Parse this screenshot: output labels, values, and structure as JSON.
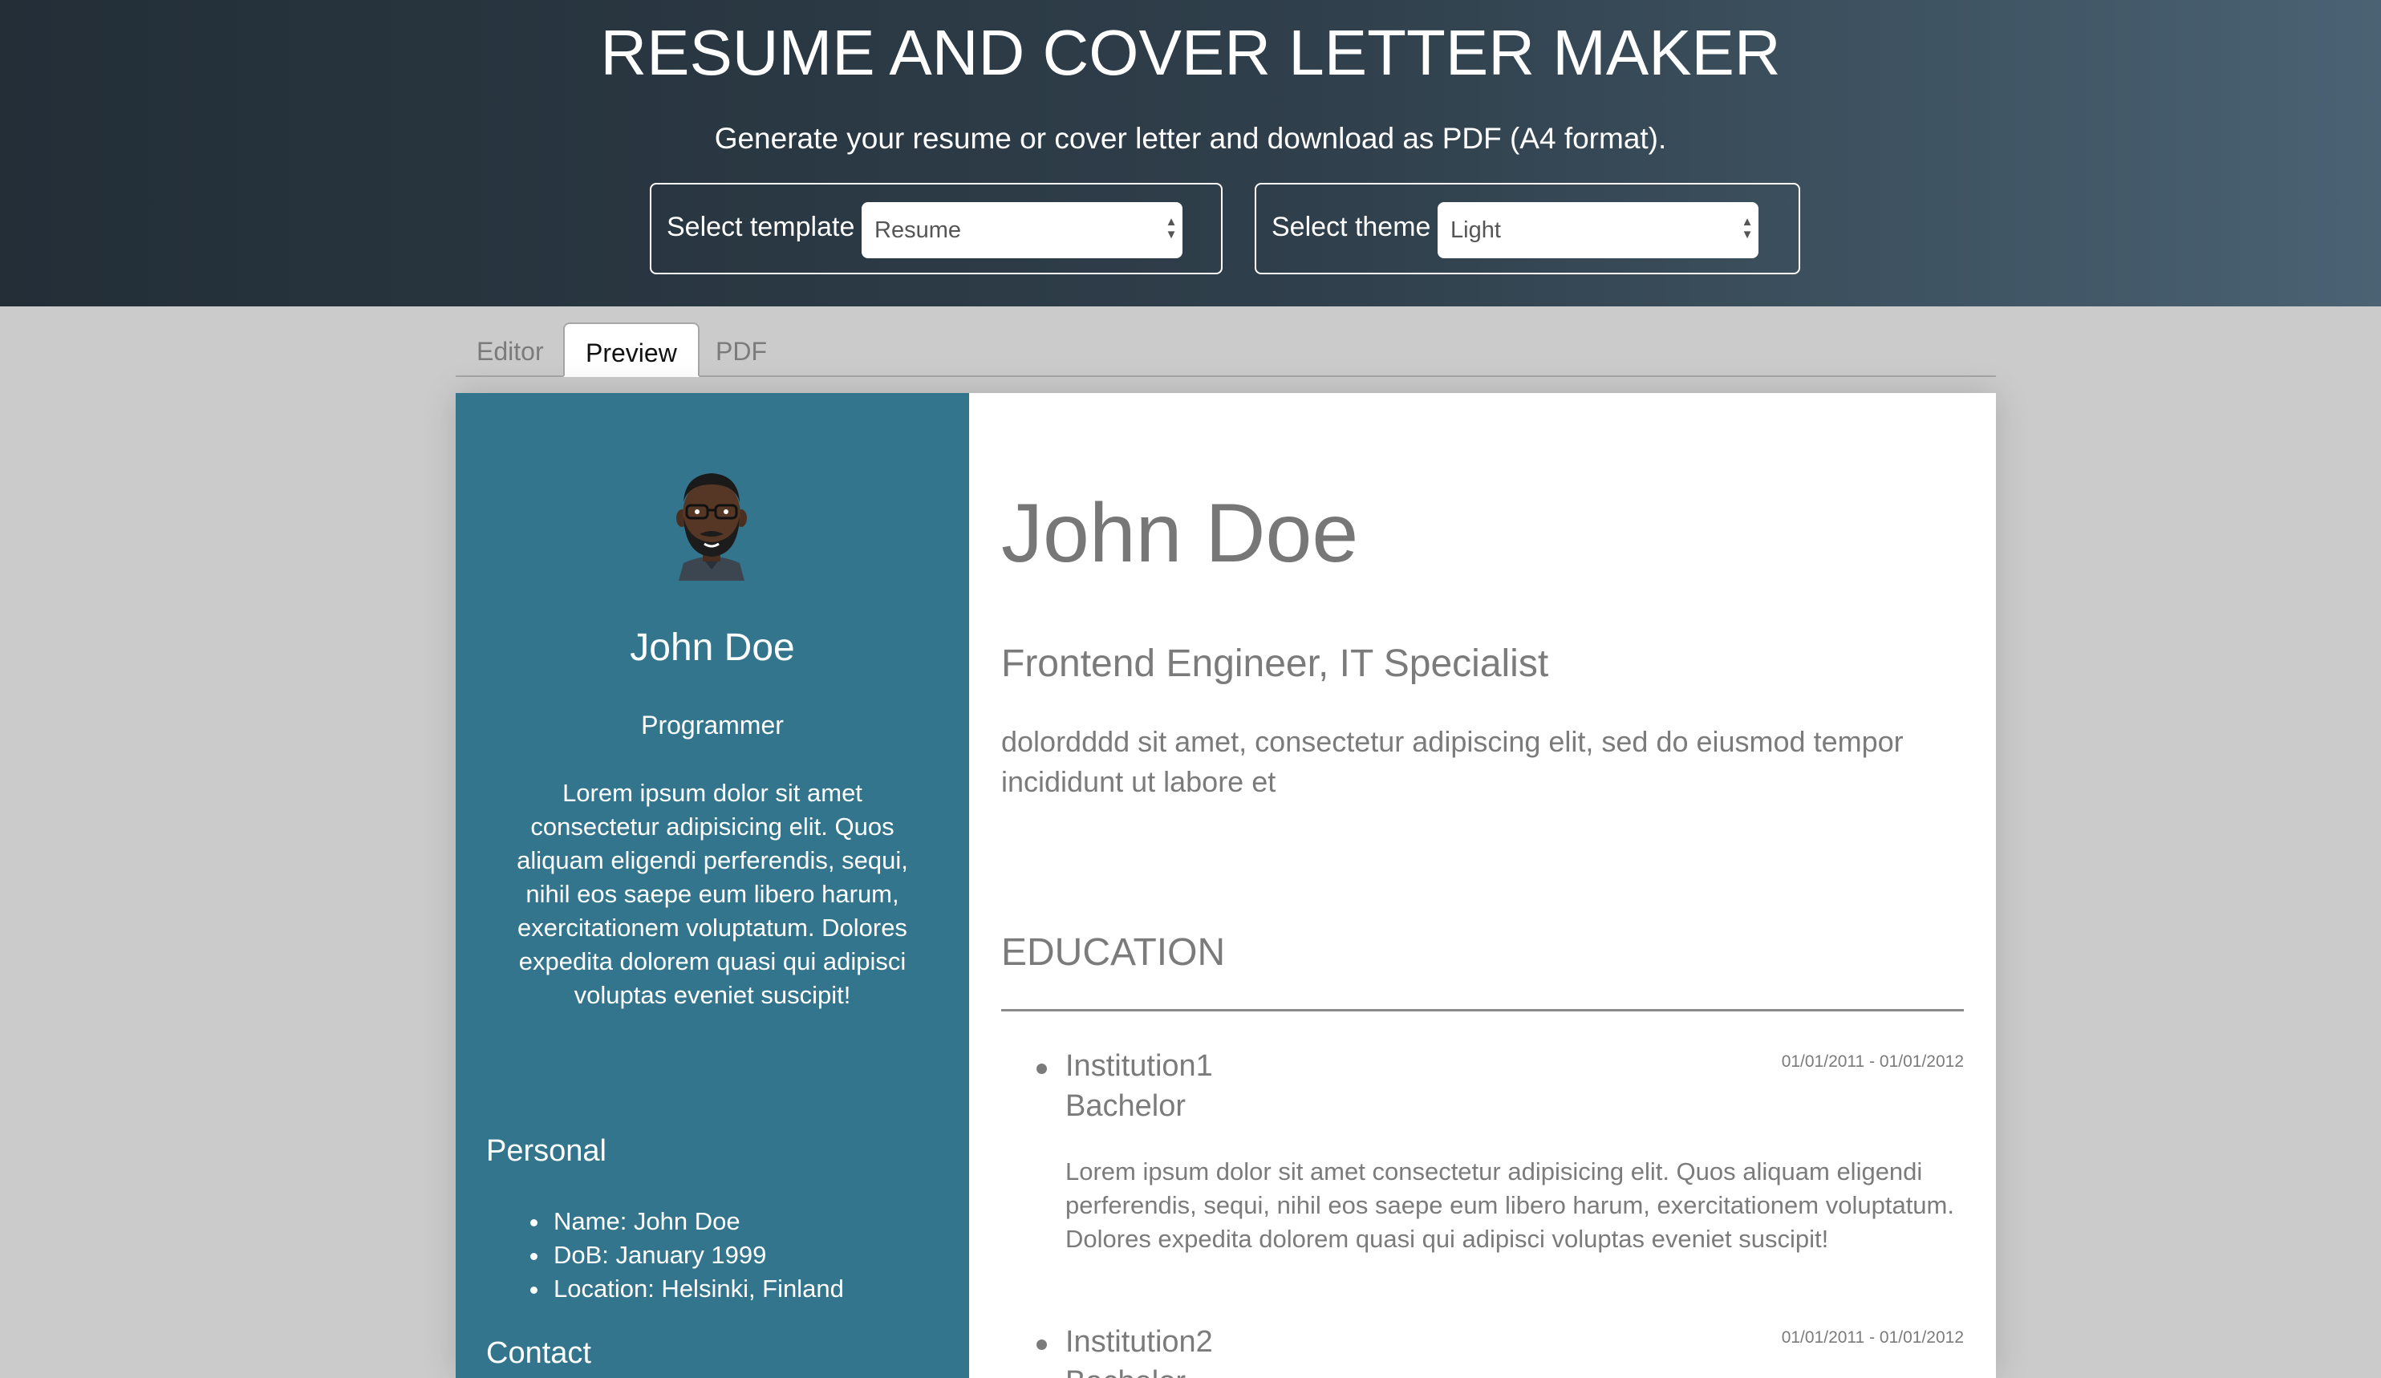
{
  "header": {
    "title": "RESUME AND COVER LETTER MAKER",
    "subtitle": "Generate your resume or cover letter and download as PDF (A4 format).",
    "template_select": {
      "label": "Select template",
      "value": "Resume"
    },
    "theme_select": {
      "label": "Select theme",
      "value": "Light"
    }
  },
  "tabs": [
    {
      "label": "Editor",
      "active": false
    },
    {
      "label": "Preview",
      "active": true
    },
    {
      "label": "PDF",
      "active": false
    }
  ],
  "sidebar": {
    "name": "John Doe",
    "role": "Programmer",
    "bio": "Lorem ipsum dolor sit amet consectetur adipisicing elit. Quos aliquam eligendi perferendis, sequi, nihil eos saepe eum libero harum, exercitationem voluptatum. Dolores expedita dolorem quasi qui adipisci voluptas eveniet suscipit!",
    "personal_title": "Personal",
    "personal_items": [
      "Name: John Doe",
      "DoB: January 1999",
      "Location: Helsinki, Finland"
    ],
    "contact_title": "Contact"
  },
  "main": {
    "name": "John Doe",
    "headline": "Frontend Engineer, IT Specialist",
    "summary": "dolordddd sit amet, consectetur adipiscing elit, sed do eiusmod tempor incididunt ut labore et",
    "education_title": "EDUCATION",
    "education": [
      {
        "institution": "Institution1",
        "degree": "Bachelor",
        "dates": "01/01/2011 - 01/01/2012",
        "description": "Lorem ipsum dolor sit amet consectetur adipisicing elit. Quos aliquam eligendi perferendis, sequi, nihil eos saepe eum libero harum, exercitationem voluptatum. Dolores expedita dolorem quasi qui adipisci voluptas eveniet suscipit!"
      },
      {
        "institution": "Institution2",
        "degree": "Bachelor",
        "dates": "01/01/2011 - 01/01/2012",
        "description": ""
      }
    ]
  },
  "colors": {
    "sidebar_bg": "#34758e",
    "header_gradient_start": "#232e37",
    "header_gradient_end": "#4a6273",
    "page_bg": "#cbcbcb"
  }
}
